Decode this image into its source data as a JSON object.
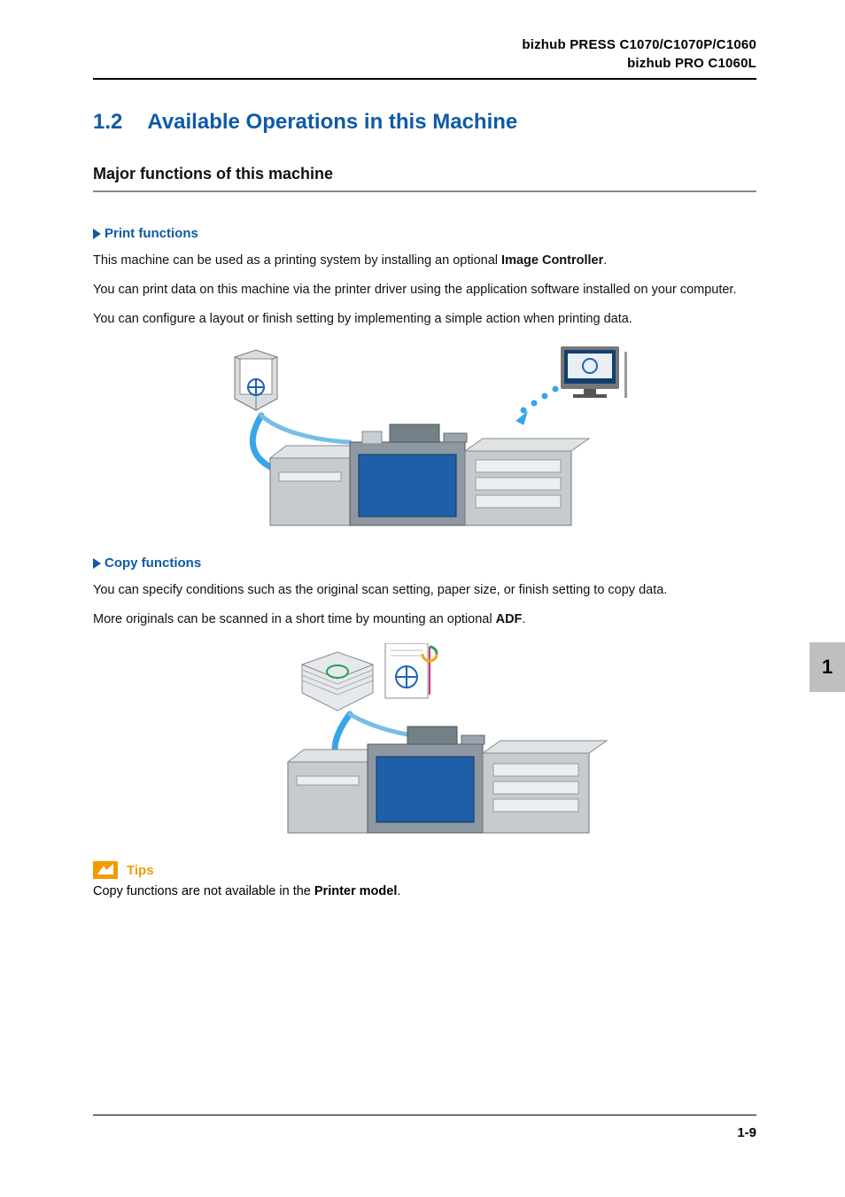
{
  "header": {
    "line1": "bizhub PRESS C1070/C1070P/C1060",
    "line2": "bizhub PRO C1060L"
  },
  "section": {
    "number": "1.2",
    "title": "Available Operations in this Machine"
  },
  "subsection": {
    "title": "Major functions of this machine"
  },
  "print": {
    "heading": "Print functions",
    "p1_a": "This machine can be used as a printing system by installing an optional ",
    "p1_bold": "Image Controller",
    "p1_b": ".",
    "p2": "You can print data on this machine via the printer driver using the application software installed on your computer.",
    "p3": "You can configure a layout or finish setting by implementing a simple action when printing data."
  },
  "copy": {
    "heading": "Copy functions",
    "p1": "You can specify conditions such as the original scan setting, paper size, or finish setting to copy data.",
    "p2_a": "More originals can be scanned in a short time by mounting an optional ",
    "p2_bold": "ADF",
    "p2_b": "."
  },
  "tips": {
    "label": "Tips",
    "text_a": "Copy functions are not available in the ",
    "text_bold": "Printer model",
    "text_b": "."
  },
  "footer": {
    "page": "1-9"
  },
  "sidetab": {
    "label": "1"
  }
}
